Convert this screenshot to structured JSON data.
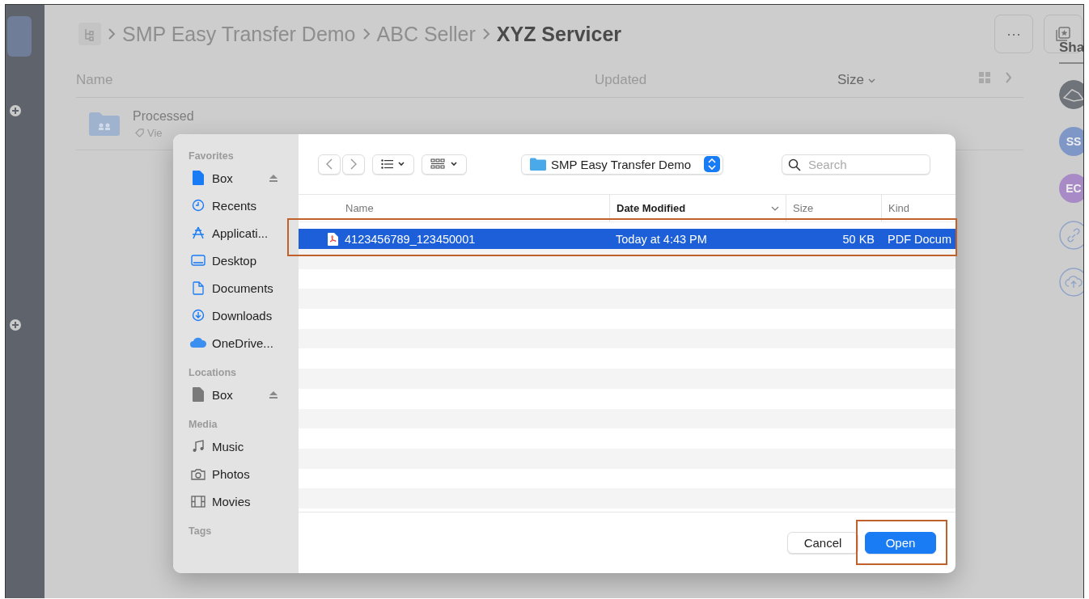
{
  "breadcrumb": {
    "items": [
      {
        "label": "SMP Easy Transfer Demo",
        "current": false
      },
      {
        "label": "ABC Seller",
        "current": false
      },
      {
        "label": "XYZ Servicer",
        "current": true
      }
    ]
  },
  "more_button": {
    "label": "···"
  },
  "list": {
    "columns": [
      {
        "label": "Name",
        "sorted": false
      },
      {
        "label": "Updated",
        "sorted": false
      },
      {
        "label": "Size",
        "sorted": true
      }
    ],
    "items": [
      {
        "name": "Processed",
        "meta": "Vie"
      }
    ]
  },
  "side_panel": {
    "title": "Sha",
    "avatars": [
      {
        "kind": "picture"
      },
      {
        "kind": "initials",
        "initials": "SS",
        "color": "#7f97c7"
      },
      {
        "kind": "initials",
        "initials": "EC",
        "color": "#a88bc6"
      },
      {
        "kind": "link"
      },
      {
        "kind": "upload"
      }
    ]
  },
  "dialog": {
    "location": "SMP Easy Transfer Demo",
    "search": {
      "placeholder": "Search"
    },
    "sidebar": [
      {
        "title": "Favorites",
        "items": [
          {
            "label": "Box",
            "kind": "drive",
            "eject": true
          },
          {
            "label": "Recents",
            "kind": "recents",
            "eject": false
          },
          {
            "label": "Applicati...",
            "kind": "apps",
            "eject": false
          },
          {
            "label": "Desktop",
            "kind": "desktop",
            "eject": false
          },
          {
            "label": "Documents",
            "kind": "documents",
            "eject": false
          },
          {
            "label": "Downloads",
            "kind": "downloads",
            "eject": false
          },
          {
            "label": "OneDrive...",
            "kind": "cloud",
            "eject": false
          }
        ]
      },
      {
        "title": "Locations",
        "items": [
          {
            "label": "Box",
            "kind": "location",
            "eject": true
          }
        ]
      },
      {
        "title": "Media",
        "items": [
          {
            "label": "Music",
            "kind": "music",
            "eject": false
          },
          {
            "label": "Photos",
            "kind": "photos",
            "eject": false
          },
          {
            "label": "Movies",
            "kind": "movies",
            "eject": false
          }
        ]
      },
      {
        "title": "Tags"
      }
    ],
    "columns": [
      {
        "label": "Name",
        "sorted": false
      },
      {
        "label": "Date Modified",
        "sorted": true
      },
      {
        "label": "Size",
        "sorted": false
      },
      {
        "label": "Kind",
        "sorted": false
      }
    ],
    "files": [
      {
        "name": "4123456789_123450001",
        "date": "Today at 4:43 PM",
        "size": "50 KB",
        "kind": "PDF Docum",
        "selected": true
      }
    ],
    "buttons": [
      {
        "label": "Cancel",
        "default": false
      },
      {
        "label": "Open",
        "default": true
      }
    ]
  }
}
